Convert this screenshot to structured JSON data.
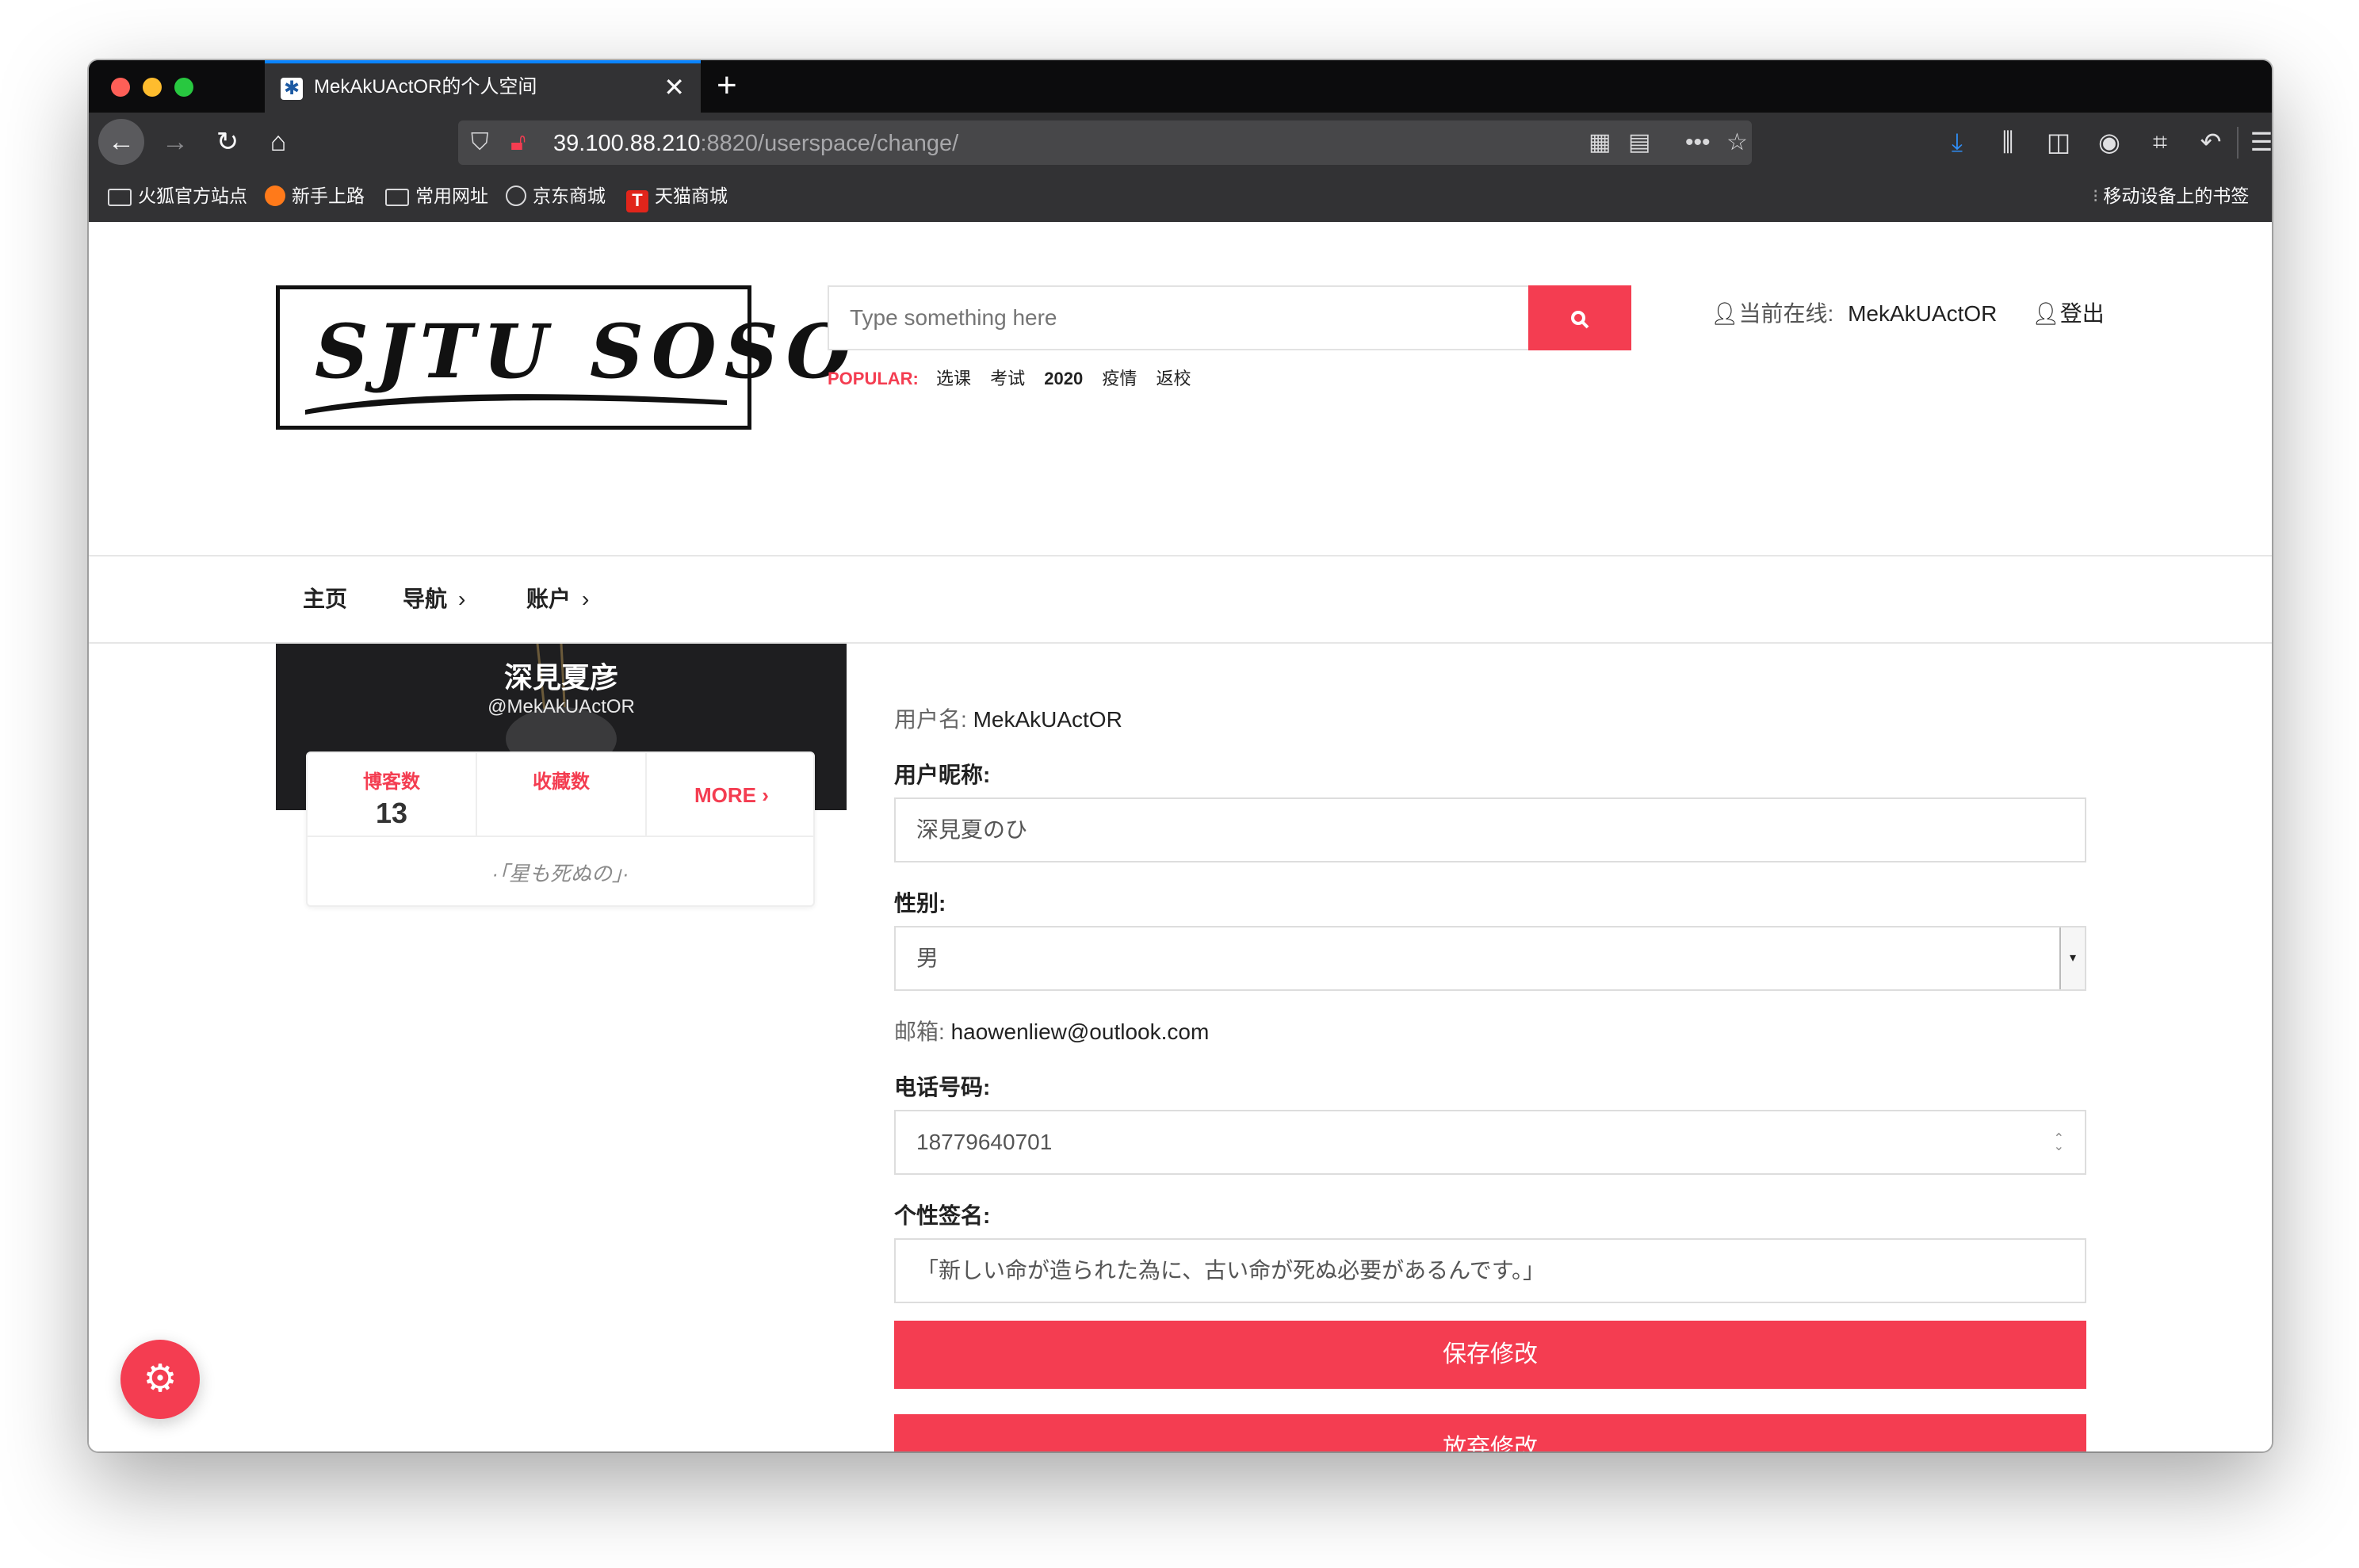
{
  "browser": {
    "tab_title": "MekAkUActOR的个人空间",
    "tab_close": "✕",
    "new_tab": "+",
    "url_host": "39.100.88.210",
    "url_path": ":8820/userspace/change/",
    "bookmarks": [
      "火狐官方站点",
      "新手上路",
      "常用网址",
      "京东商城",
      "天猫商城"
    ],
    "mobile_bookmarks": "移动设备上的书签"
  },
  "header": {
    "logo_text": "SJTU SOSO",
    "search_placeholder": "Type something here",
    "search_icon": "search-icon",
    "popular_label": "POPULAR:",
    "popular_tags": [
      "选课",
      "考试",
      "2020",
      "疫情",
      "返校"
    ],
    "online_label": "当前在线:",
    "online_user": "MekAkUActOR",
    "logout": "登出"
  },
  "menu": {
    "home": "主页",
    "nav": "导航",
    "account": "账户"
  },
  "profile": {
    "name": "深見夏彦",
    "handle": "@MekAkUActOR",
    "blog_label": "博客数",
    "blog_count": "13",
    "fav_label": "收藏数",
    "more": "MORE",
    "motto": "·「星も死ぬの」·"
  },
  "form": {
    "username_label": "用户名:",
    "username": "MekAkUActOR",
    "nickname_label": "用户昵称:",
    "nickname": "深見夏のひ",
    "gender_label": "性别:",
    "gender": "男",
    "email_label": "邮箱:",
    "email": "haowenliew@outlook.com",
    "phone_label": "电话号码:",
    "phone": "18779640701",
    "signature_label": "个性签名:",
    "signature": "「新しい命が造られた為に、古い命が死ぬ必要があるんです。」",
    "save": "保存修改",
    "discard": "放弃修改"
  },
  "colors": {
    "accent": "#f43d51",
    "chrome": "#323234",
    "tabbar": "#0c0c0d"
  }
}
